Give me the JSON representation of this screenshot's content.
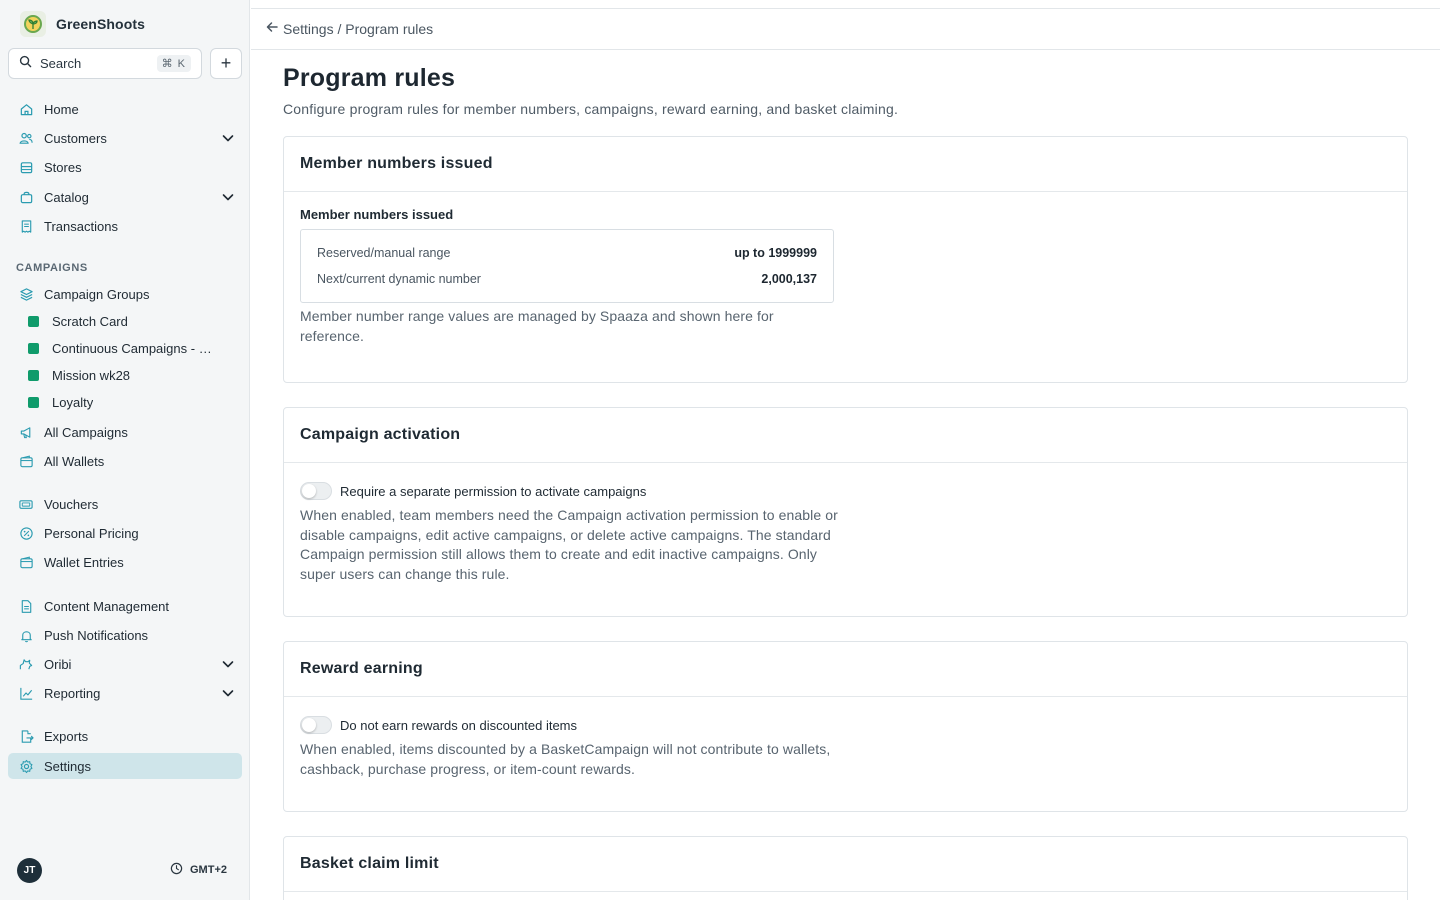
{
  "brand": {
    "name": "GreenShoots"
  },
  "search": {
    "label": "Search",
    "shortcut": "⌘ K"
  },
  "sidebar": {
    "items": [
      {
        "label": "Home",
        "icon": "home-icon"
      },
      {
        "label": "Customers",
        "icon": "users-icon",
        "expandable": true
      },
      {
        "label": "Stores",
        "icon": "store-icon"
      },
      {
        "label": "Catalog",
        "icon": "bag-icon",
        "expandable": true
      },
      {
        "label": "Transactions",
        "icon": "receipt-icon"
      }
    ],
    "campaigns_section": "CAMPAIGNS",
    "campaign_groups": {
      "label": "Campaign Groups",
      "icon": "layers-icon"
    },
    "groups": [
      {
        "label": "Scratch Card"
      },
      {
        "label": "Continuous Campaigns - …"
      },
      {
        "label": "Mission wk28"
      },
      {
        "label": "Loyalty"
      }
    ],
    "items2": [
      {
        "label": "All Campaigns",
        "icon": "megaphone-icon"
      },
      {
        "label": "All Wallets",
        "icon": "wallet-icon"
      },
      {
        "label": "Vouchers",
        "icon": "ticket-icon"
      },
      {
        "label": "Personal Pricing",
        "icon": "percent-icon"
      },
      {
        "label": "Wallet Entries",
        "icon": "wallet-entries-icon"
      },
      {
        "label": "Content Management",
        "icon": "document-icon"
      },
      {
        "label": "Push Notifications",
        "icon": "bell-icon"
      },
      {
        "label": "Oribi",
        "icon": "oribi-icon",
        "expandable": true
      },
      {
        "label": "Reporting",
        "icon": "chart-icon",
        "expandable": true
      },
      {
        "label": "Exports",
        "icon": "export-icon"
      },
      {
        "label": "Settings",
        "icon": "gear-icon",
        "active": true
      }
    ],
    "group_color": "#0f9b6b",
    "accent_color": "#2a9bb0"
  },
  "footer": {
    "avatar": "JT",
    "timezone": "GMT+2"
  },
  "breadcrumb": {
    "text": "Settings / Program rules"
  },
  "page": {
    "title": "Program rules",
    "subtitle": "Configure program rules for member numbers, campaigns, reward earning, and basket claiming."
  },
  "cards": {
    "member_numbers": {
      "title": "Member numbers issued",
      "field_label": "Member numbers issued",
      "rows": [
        {
          "key": "Reserved/manual range",
          "value": "up to 1999999"
        },
        {
          "key": "Next/current dynamic number",
          "value": "2,000,137"
        }
      ],
      "help": "Member number range values are managed by Spaaza and shown here for reference."
    },
    "campaign_activation": {
      "title": "Campaign activation",
      "toggle_label": "Require a separate permission to activate campaigns",
      "toggle_on": false,
      "help": "When enabled, team members need the Campaign activation permission to enable or disable campaigns, edit active campaigns, or delete active campaigns. The standard Campaign permission still allows them to create and edit inactive campaigns. Only super users can change this rule."
    },
    "reward_earning": {
      "title": "Reward earning",
      "toggle_label": "Do not earn rewards on discounted items",
      "toggle_on": false,
      "help": "When enabled, items discounted by a BasketCampaign will not contribute to wallets, cashback, purchase progress, or item-count rewards."
    },
    "basket_claim": {
      "title": "Basket claim limit"
    }
  }
}
